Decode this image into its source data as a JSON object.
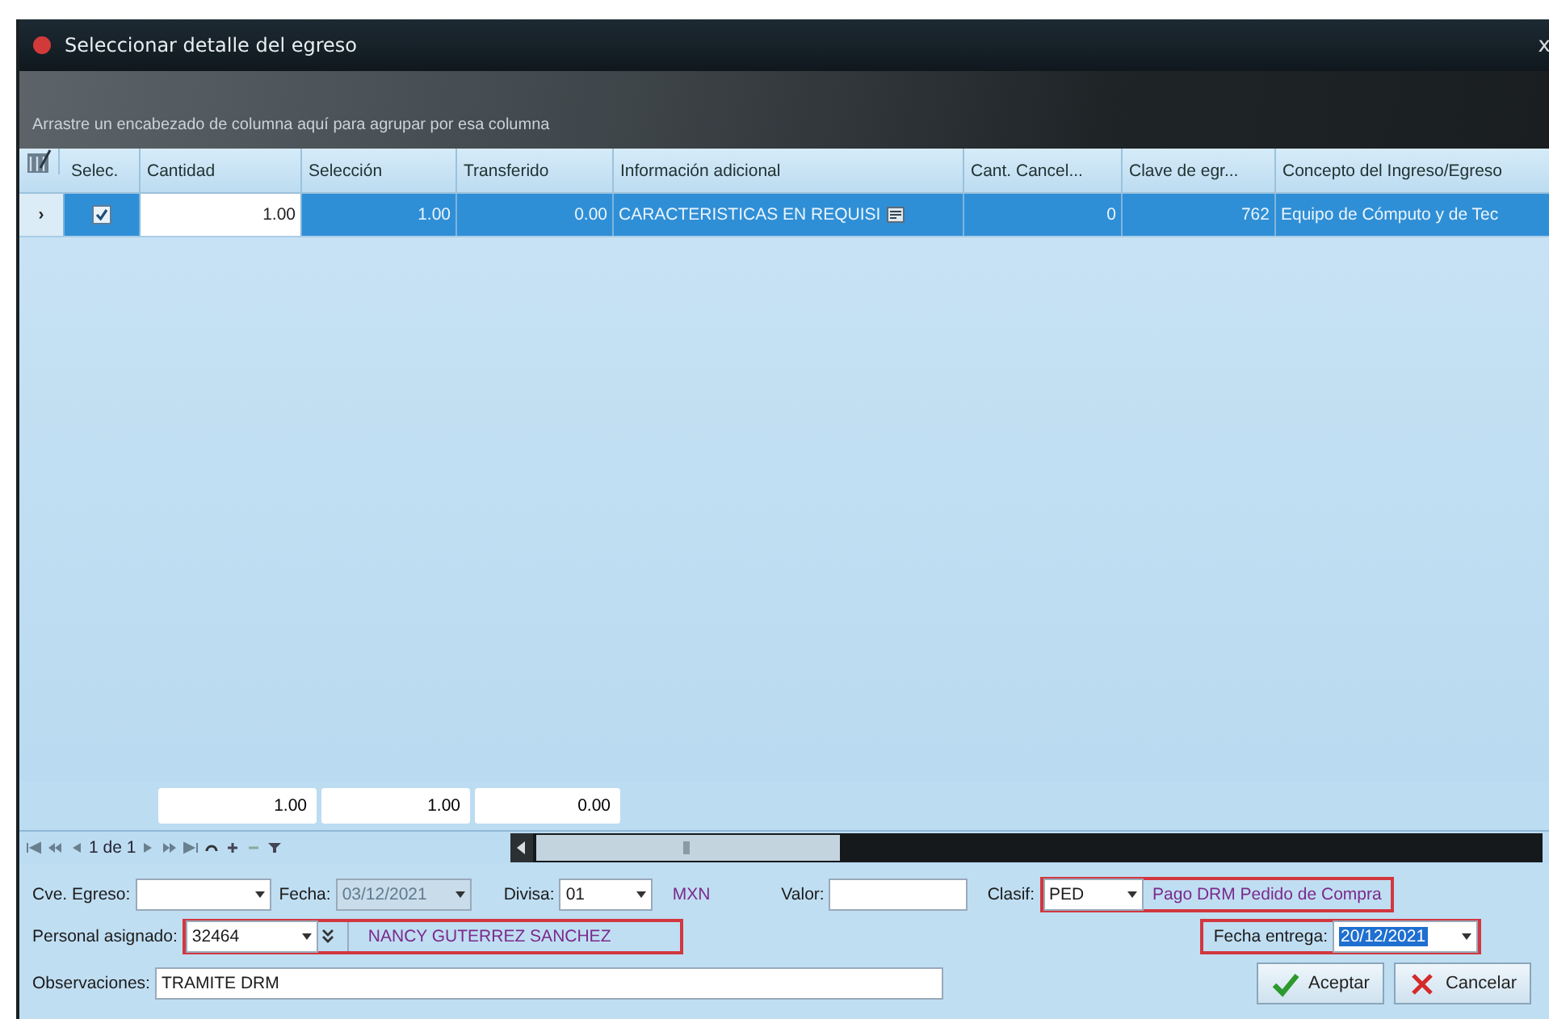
{
  "window": {
    "title": "Seleccionar detalle del egreso",
    "close": "x"
  },
  "group_panel": {
    "hint": "Arrastre un encabezado de columna aquí para agrupar por esa columna"
  },
  "table": {
    "columns": [
      "Selec.",
      "Cantidad",
      "Selección",
      "Transferido",
      "Información adicional",
      "Cant. Cancel...",
      "Clave de egr...",
      "Concepto del Ingreso/Egreso"
    ],
    "rows": [
      {
        "indicator": "›",
        "selected": true,
        "checked": true,
        "cells": [
          "",
          "1.00",
          "1.00",
          "0.00",
          "CARACTERISTICAS EN REQUISI",
          "0",
          "762",
          "Equipo de Cómputo y de Tec"
        ]
      }
    ],
    "totals": [
      "1.00",
      "1.00",
      "0.00"
    ]
  },
  "navigator": {
    "page": "1 de 1"
  },
  "form": {
    "cve_egreso": {
      "label": "Cve. Egreso:"
    },
    "fecha": {
      "label": "Fecha:",
      "value": "03/12/2021",
      "disabled": true
    },
    "divisa": {
      "label": "Divisa:",
      "value": "01",
      "description": "MXN"
    },
    "valor": {
      "label": "Valor:"
    },
    "clasif": {
      "label": "Clasif:",
      "value": "PED",
      "description": "Pago DRM Pedido de Compra",
      "highlighted": true
    },
    "personal": {
      "label": "Personal asignado:",
      "value": "32464",
      "description": "NANCY GUTERREZ SANCHEZ",
      "highlighted": true
    },
    "fecha_entrega": {
      "label": "Fecha entrega:",
      "value": "20/12/2021",
      "value_selected": true,
      "highlighted": true
    },
    "observaciones": {
      "label": "Observaciones:",
      "value": "TRAMITE DRM"
    }
  },
  "buttons": [
    {
      "kind": "accept",
      "label": "Aceptar"
    },
    {
      "kind": "cancel",
      "label": "Cancelar"
    }
  ]
}
